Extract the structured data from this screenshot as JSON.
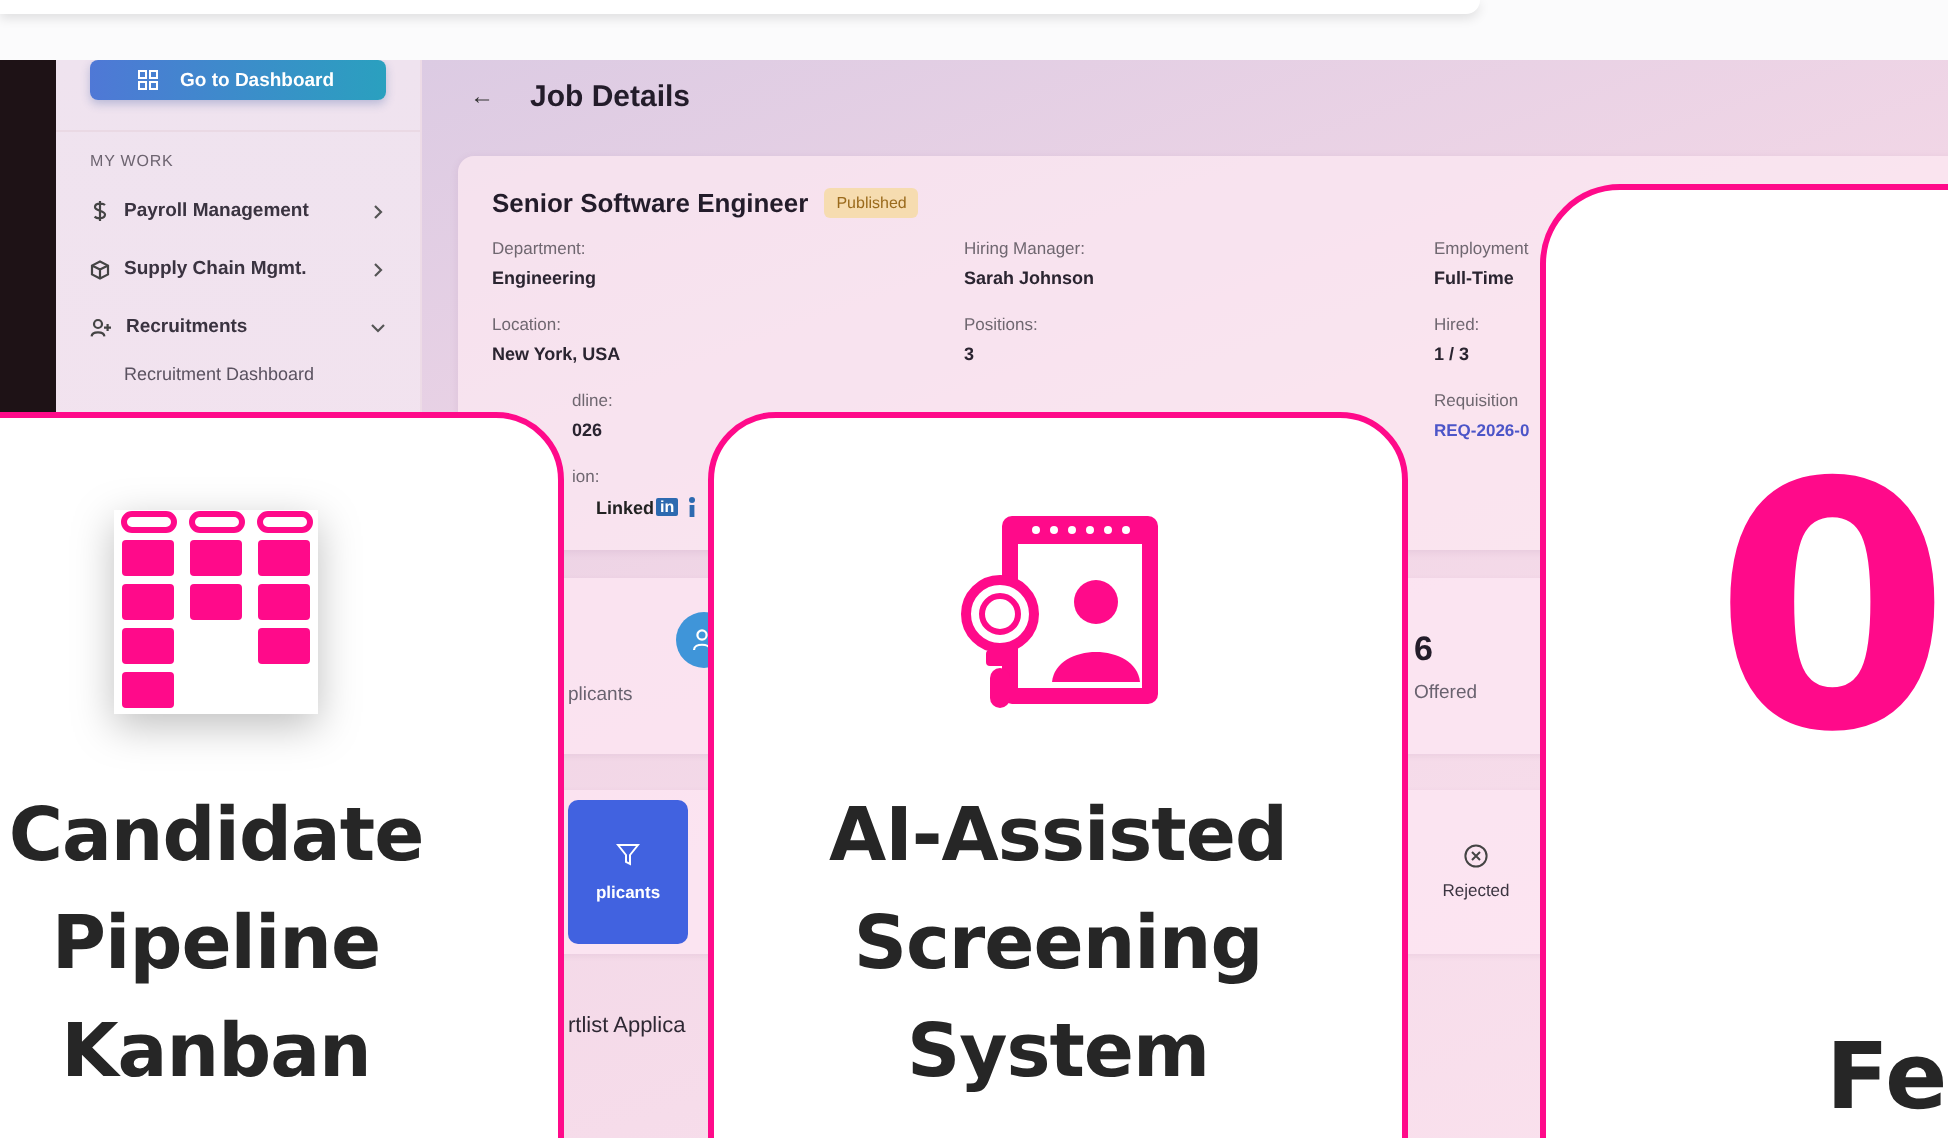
{
  "sidebar": {
    "dashboard_button": "Go to Dashboard",
    "section": "MY WORK",
    "items": [
      {
        "label": "Payroll Management",
        "expanded": false
      },
      {
        "label": "Supply Chain Mgmt.",
        "expanded": false
      },
      {
        "label": "Recruitments",
        "expanded": true,
        "children": [
          {
            "label": "Recruitment Dashboard"
          }
        ]
      }
    ]
  },
  "page": {
    "back": "←",
    "title": "Job Details"
  },
  "job": {
    "title": "Senior Software Engineer",
    "status": "Published",
    "fields": [
      {
        "kind": "text",
        "label": "Department:",
        "value": "Engineering"
      },
      {
        "kind": "text",
        "label": "Hiring Manager:",
        "value": "Sarah Johnson"
      },
      {
        "kind": "text",
        "label": "Employment",
        "value": "Full-Time"
      },
      {
        "kind": "text",
        "label": "Location:",
        "value": "New York, USA"
      },
      {
        "kind": "text",
        "label": "Positions:",
        "value": "3"
      },
      {
        "kind": "text",
        "label": "Hired:",
        "value": "1 / 3"
      },
      {
        "kind": "partial",
        "label": "dline:",
        "value": "026"
      },
      {
        "kind": "blank"
      },
      {
        "kind": "link",
        "label": "Requisition",
        "value": "REQ-2026-0"
      },
      {
        "kind": "logos",
        "label": "ion:",
        "logo_text": "Linked",
        "logo_mark": "in"
      }
    ]
  },
  "stats": {
    "left_label": "plicants",
    "right_value": "6",
    "right_label": "Offered"
  },
  "filters": {
    "button_label": "plicants",
    "right_label": "Rejected"
  },
  "section_title": "rtlist Applica",
  "cards": [
    {
      "kind": "kanban",
      "title": "Candidate Pipeline Kanban"
    },
    {
      "kind": "screening",
      "title": "AI-Assisted Screening System"
    },
    {
      "kind": "number",
      "value": "0",
      "caption": "Fe"
    }
  ]
}
